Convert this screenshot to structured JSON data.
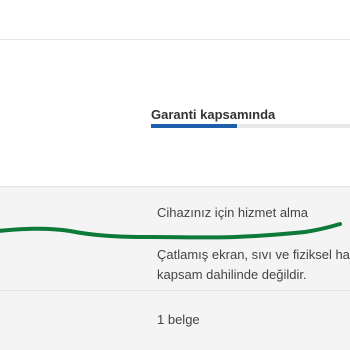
{
  "coverage": {
    "status_label": "Garanti kapsamında",
    "progress_fraction": 0.43
  },
  "service": {
    "title": "Cihazınız için hizmet alma",
    "description_lines": [
      "Çatlamış ekran, sıvı ve fiziksel ha",
      "kapsam dahilinde değildir."
    ]
  },
  "documents": {
    "count_label": "1 belge"
  },
  "colors": {
    "accent": "#1f5faa",
    "annotation_stroke": "#0e7a3a"
  }
}
